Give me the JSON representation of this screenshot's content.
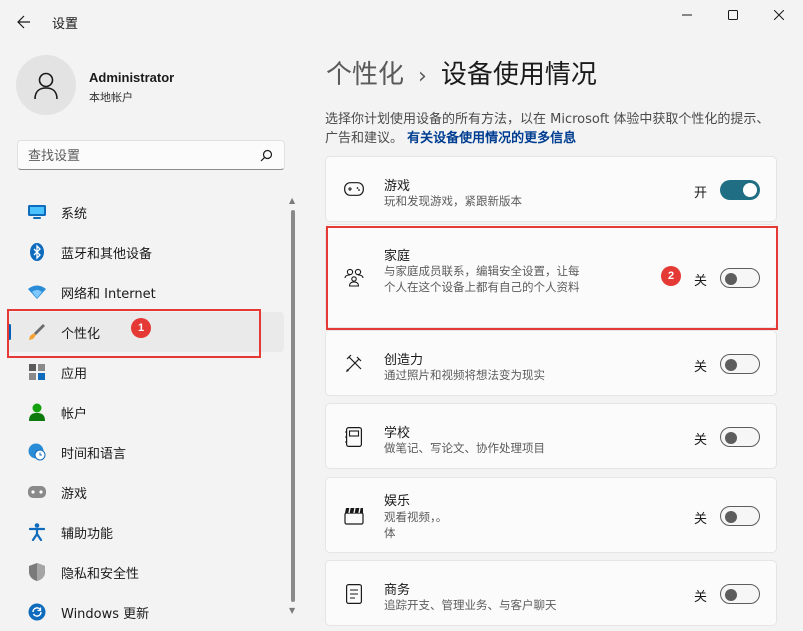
{
  "window": {
    "title": "设置"
  },
  "user": {
    "name": "Administrator",
    "account_type": "本地帐户"
  },
  "search": {
    "placeholder": "查找设置"
  },
  "sidebar": {
    "items": [
      {
        "label": "系统",
        "icon": "system-icon"
      },
      {
        "label": "蓝牙和其他设备",
        "icon": "bluetooth-icon"
      },
      {
        "label": "网络和 Internet",
        "icon": "network-icon"
      },
      {
        "label": "个性化",
        "icon": "brush-icon",
        "active": true
      },
      {
        "label": "应用",
        "icon": "apps-icon"
      },
      {
        "label": "帐户",
        "icon": "account-icon"
      },
      {
        "label": "时间和语言",
        "icon": "globe-clock-icon"
      },
      {
        "label": "游戏",
        "icon": "gamepad-icon"
      },
      {
        "label": "辅助功能",
        "icon": "accessibility-icon"
      },
      {
        "label": "隐私和安全性",
        "icon": "shield-icon"
      },
      {
        "label": "Windows 更新",
        "icon": "update-icon"
      }
    ]
  },
  "annotations": {
    "badge1": "1",
    "badge2": "2"
  },
  "main": {
    "breadcrumb_parent": "个性化",
    "breadcrumb_separator": "›",
    "breadcrumb_current": "设备使用情况",
    "description": "选择你计划使用设备的所有方法，以在 Microsoft 体验中获取个性化的提示、广告和建议。",
    "description_link": "有关设备使用情况的更多信息",
    "options": [
      {
        "title": "游戏",
        "subtitle": "玩和发现游戏，紧跟新版本",
        "state_label": "开",
        "on": true,
        "icon": "gamepad-icon"
      },
      {
        "title": "家庭",
        "subtitle": "与家庭成员联系，编辑安全设置，让每个人在这个设备上都有自己的个人资料",
        "state_label": "关",
        "on": false,
        "icon": "family-icon"
      },
      {
        "title": "创造力",
        "subtitle": "通过照片和视频将想法变为现实",
        "state_label": "关",
        "on": false,
        "icon": "creativity-icon"
      },
      {
        "title": "学校",
        "subtitle": "做笔记、写论文、协作处理项目",
        "state_label": "关",
        "on": false,
        "icon": "school-icon"
      },
      {
        "title": "娱乐",
        "subtitle": "观看视频，。\n体",
        "state_label": "关",
        "on": false,
        "icon": "clapperboard-icon"
      },
      {
        "title": "商务",
        "subtitle": "追踪开支、管理业务、与客户聊天",
        "state_label": "关",
        "on": false,
        "icon": "business-icon"
      }
    ]
  },
  "colors": {
    "accent": "#005fb8",
    "toggle_on": "#1f6e84",
    "annotation": "#e53935"
  }
}
